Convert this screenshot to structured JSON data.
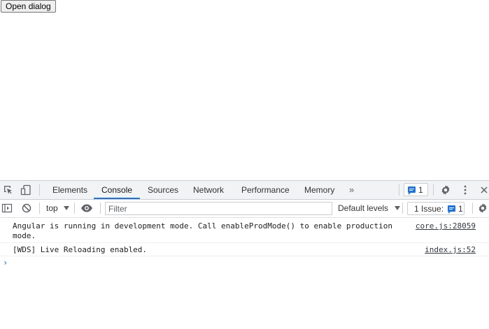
{
  "page": {
    "open_dialog_label": "Open dialog"
  },
  "devtools": {
    "tabs": [
      {
        "label": "Elements",
        "active": false
      },
      {
        "label": "Console",
        "active": true
      },
      {
        "label": "Sources",
        "active": false
      },
      {
        "label": "Network",
        "active": false
      },
      {
        "label": "Performance",
        "active": false
      },
      {
        "label": "Memory",
        "active": false
      }
    ],
    "more_tabs_glyph": "»",
    "message_badge_count": "1",
    "icons": {
      "inspect": "inspect-element-icon",
      "device": "device-toolbar-icon",
      "settings": "gear-icon",
      "menu": "kebab-menu-icon",
      "close": "close-icon",
      "sidebar": "sidebar-toggle-icon",
      "clear": "clear-console-icon",
      "eye": "live-expression-icon",
      "console_settings": "gear-icon"
    },
    "console_toolbar": {
      "context": "top",
      "filter_placeholder": "Filter",
      "levels_label": "Default levels",
      "issues_label": "1 Issue:",
      "issues_count": "1"
    },
    "messages": [
      {
        "text": "Angular is running in development mode. Call enableProdMode() to enable production\nmode.",
        "source": "core.js:28059"
      },
      {
        "text": "[WDS] Live Reloading enabled.",
        "source": "index.js:52"
      }
    ],
    "prompt_glyph": "›",
    "colors": {
      "accent": "#1a73e8",
      "toolbar_bg": "#f1f3f4",
      "border": "#cacdd1"
    }
  }
}
